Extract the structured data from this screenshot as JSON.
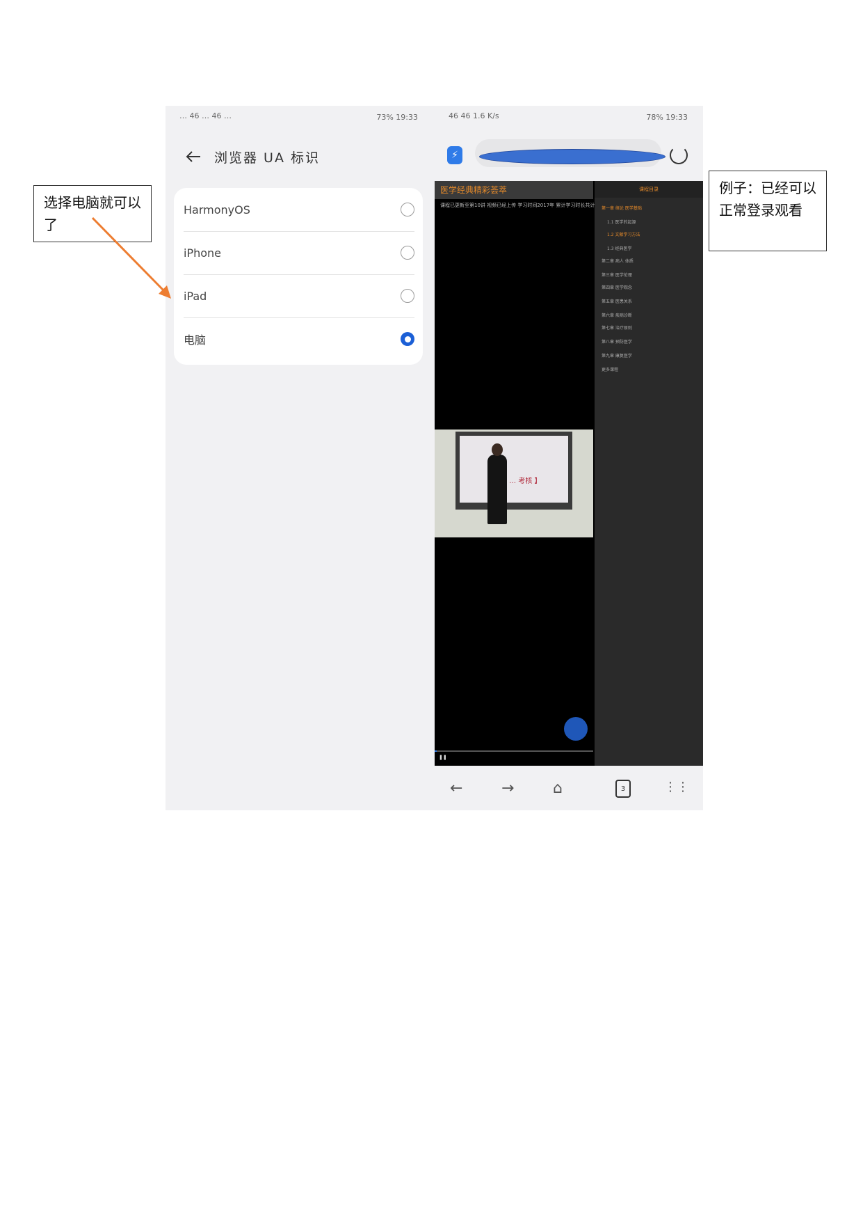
{
  "left_phone": {
    "status_left": "… 46 … 46 …",
    "status_right": "73% 19:33",
    "title": "浏览器 UA 标识",
    "options": [
      {
        "label": "HarmonyOS",
        "selected": false
      },
      {
        "label": "iPhone",
        "selected": false
      },
      {
        "label": "iPad",
        "selected": false
      },
      {
        "label": "电脑",
        "selected": true
      }
    ]
  },
  "right_phone": {
    "status_left": "46 46 1.6 K/s",
    "status_right": "78% 19:33",
    "web_title": "医学经典精彩荟萃",
    "web_subtitle": "课程已更新至第10讲 视频已经上传 学习时间2017年 累计学习时长共计",
    "sidebar_head": "课程目录",
    "sidebar_items": [
      "第一章 绪论 医学基础",
      "1.1 医学的起源",
      "1.2 文献学习方法",
      "1.3 经典医学",
      "第二章 病人 体质",
      "第三章 医学伦理",
      "第四章 医学观念",
      "第五章 医患关系",
      "第六章 疾病诊断",
      "第七章 治疗原则",
      "第八章 预防医学",
      "第九章 康复医学",
      "更多课程"
    ],
    "board_text": "【 … 考核 】",
    "tab_count": "3"
  },
  "callouts": {
    "left": "选择电脑就可以了",
    "right": "例子：已经可以正常登录观看"
  },
  "colors": {
    "accent": "#1b5fd6",
    "arrow": "#ed7d31",
    "web_accent": "#e58a2a"
  }
}
